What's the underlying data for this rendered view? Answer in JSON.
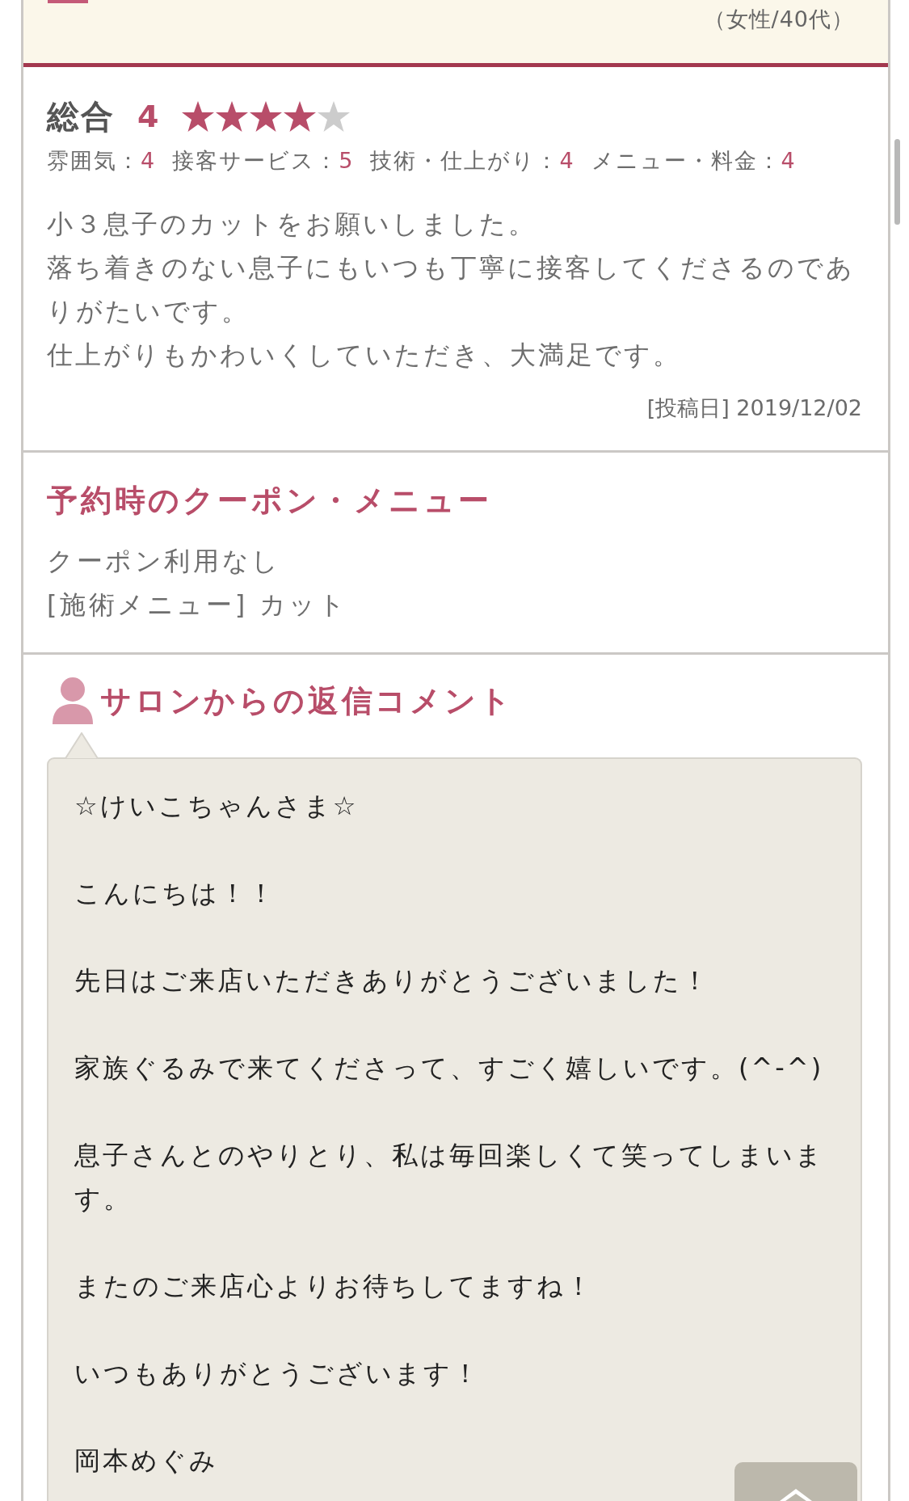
{
  "reviewer": {
    "attributes": "（女性/40代）"
  },
  "ratings": {
    "label": "総合",
    "score": "4",
    "stars": 4,
    "categories": [
      {
        "label": "雰囲気：",
        "score": "4"
      },
      {
        "label": "接客サービス：",
        "score": "5"
      },
      {
        "label": "技術・仕上がり：",
        "score": "4"
      },
      {
        "label": "メニュー・料金：",
        "score": "4"
      }
    ]
  },
  "review": {
    "lines": [
      "小３息子のカットをお願いしました。",
      "落ち着きのない息子にもいつも丁寧に接客してくださるのでありがたいです。",
      "仕上がりもかわいくしていただき、大満足です。"
    ],
    "posted": "[投稿日] 2019/12/02"
  },
  "booking": {
    "title": "予約時のクーポン・メニュー",
    "lines": [
      "クーポン利用なし",
      "[施術メニュー] カット"
    ]
  },
  "salon_reply": {
    "title": "サロンからの返信コメント",
    "paragraphs": [
      "☆けいこちゃんさま☆",
      "こんにちは！！",
      "先日はご来店いただきありがとうございました！",
      "家族ぐるみで来てくださって、すごく嬉しいです。(^-^)",
      "息子さんとのやりとり、私は毎回楽しくて笑ってしまいます。",
      "またのご来店心よりお待ちしてますね！",
      "いつもありがとうございます！",
      "岡本めぐみ"
    ]
  }
}
